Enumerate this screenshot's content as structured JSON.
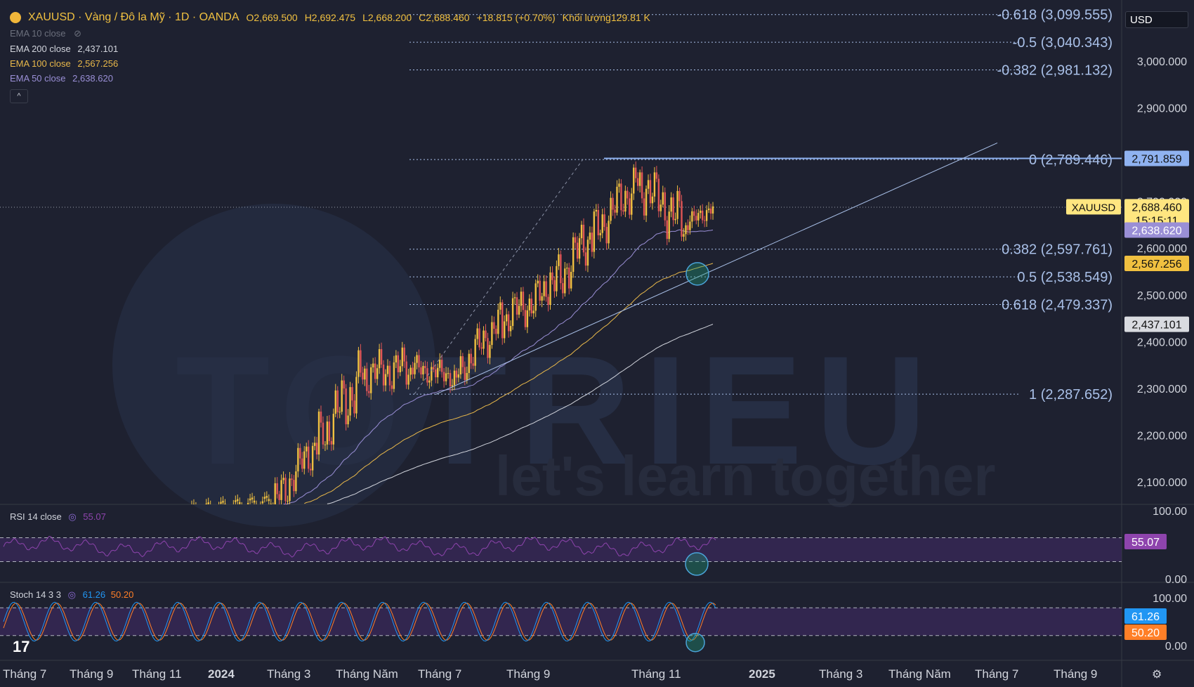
{
  "header": {
    "symbol": "XAUUSD · Vàng / Đô la Mỹ · 1D · OANDA",
    "open": "O2,669.500",
    "high": "H2,692.475",
    "low": "L2,668.200",
    "close": "C2,688.460",
    "change": "+18.815 (+0.70%)",
    "volume_label": "Khối lượng",
    "volume": "129.81 K"
  },
  "indicators": [
    {
      "label": "EMA 10 close",
      "value": "",
      "color": "#6b6f7c",
      "hidden": true
    },
    {
      "label": "EMA 200 close",
      "value": "2,437.101",
      "color": "#d1d4dc"
    },
    {
      "label": "EMA 100 close",
      "value": "2,567.256",
      "color": "#e8b84a"
    },
    {
      "label": "EMA 50 close",
      "value": "2,638.620",
      "color": "#9a8fd6"
    }
  ],
  "currency": "USD",
  "rsi": {
    "label": "RSI 14 close",
    "value": "55.07",
    "levels": [
      "100.00",
      "0.00"
    ],
    "color": "#8e44ad"
  },
  "stoch": {
    "label": "Stoch 14 3 3",
    "k": "61.26",
    "d": "50.20",
    "levels": [
      "100.00",
      "0.00"
    ],
    "k_color": "#2196f3",
    "d_color": "#ff7f27"
  },
  "price_axis": [
    "3,000.000",
    "2,900.000",
    "2,800.000",
    "2,700.000",
    "2,600.000",
    "2,500.000",
    "2,400.000",
    "2,300.000",
    "2,200.000",
    "2,100.000"
  ],
  "time_axis": [
    "Tháng 7",
    "Tháng 9",
    "Tháng 11",
    "2024",
    "Tháng 3",
    "Tháng Năm",
    "Tháng 7",
    "Tháng 9",
    "Tháng 11",
    "2025",
    "Tháng 3",
    "Tháng Năm",
    "Tháng 7",
    "Tháng 9"
  ],
  "fib_levels": [
    {
      "ratio": "-0.618",
      "price": 3099.555,
      "label": "-0.618 (3,099.555)"
    },
    {
      "ratio": "-0.5",
      "price": 3040.343,
      "label": "-0.5 (3,040.343)"
    },
    {
      "ratio": "-0.382",
      "price": 2981.132,
      "label": "-0.382 (2,981.132)"
    },
    {
      "ratio": "0",
      "price": 2789.446,
      "label": "0 (2,789.446)"
    },
    {
      "ratio": "0.382",
      "price": 2597.761,
      "label": "0.382 (2,597.761)"
    },
    {
      "ratio": "0.5",
      "price": 2538.549,
      "label": "0.5 (2,538.549)"
    },
    {
      "ratio": "0.618",
      "price": 2479.337,
      "label": "0.618 (2,479.337)"
    },
    {
      "ratio": "1",
      "price": 2287.652,
      "label": "1 (2,287.652)"
    }
  ],
  "price_tags": [
    {
      "value": 2791.859,
      "text": "2,791.859",
      "bg": "#8fb2f0",
      "fg": "#111"
    },
    {
      "value": 2688.46,
      "text": "2,688.460",
      "bg": "#ffe680",
      "fg": "#111",
      "sub": "15:15:11",
      "symbol": "XAUUSD"
    },
    {
      "value": 2638.62,
      "text": "2,638.620",
      "bg": "#9a8fd6",
      "fg": "#fff"
    },
    {
      "value": 2567.256,
      "text": "2,567.256",
      "bg": "#f0c040",
      "fg": "#111"
    },
    {
      "value": 2437.101,
      "text": "2,437.101",
      "bg": "#d9dbe0",
      "fg": "#111"
    }
  ],
  "watermark": {
    "brand": "TOTRIEU",
    "slogan": "let's learn together"
  },
  "colors": {
    "background": "#1e2130",
    "up": "#f0c040",
    "down": "#e05555",
    "fib": "#a9c0e8",
    "trend": "#a9c0e8",
    "circle": "#1fa37a"
  },
  "chart_data": {
    "type": "candlestick",
    "title": "XAUUSD · Vàng / Đô la Mỹ · 1D · OANDA",
    "ylim": [
      2050,
      3130
    ],
    "x_range_days": [
      0,
      640
    ],
    "candles_monthly_ohlc_approx": [
      {
        "month": "2024-03",
        "open": 2050,
        "high": 2195,
        "low": 2030,
        "close": 2185
      },
      {
        "month": "2024-04",
        "open": 2185,
        "high": 2431,
        "low": 2180,
        "close": 2330
      },
      {
        "month": "2024-05",
        "open": 2330,
        "high": 2450,
        "low": 2280,
        "close": 2345
      },
      {
        "month": "2024-06",
        "open": 2345,
        "high": 2388,
        "low": 2290,
        "close": 2326
      },
      {
        "month": "2024-07",
        "open": 2326,
        "high": 2484,
        "low": 2318,
        "close": 2447
      },
      {
        "month": "2024-08",
        "open": 2447,
        "high": 2531,
        "low": 2364,
        "close": 2503
      },
      {
        "month": "2024-09",
        "open": 2503,
        "high": 2685,
        "low": 2472,
        "close": 2634
      },
      {
        "month": "2024-10",
        "open": 2634,
        "high": 2790,
        "low": 2603,
        "close": 2743
      },
      {
        "month": "2024-11",
        "open": 2743,
        "high": 2762,
        "low": 2536,
        "close": 2650
      },
      {
        "month": "2024-12",
        "open": 2650,
        "high": 2692,
        "low": 2620,
        "close": 2688
      }
    ],
    "ema": [
      {
        "name": "EMA 200 close",
        "last": 2437.101
      },
      {
        "name": "EMA 100 close",
        "last": 2567.256
      },
      {
        "name": "EMA 50 close",
        "last": 2638.62
      }
    ],
    "rsi": {
      "name": "RSI 14 close",
      "last": 55.07,
      "bands": [
        70,
        30
      ]
    },
    "stoch": {
      "name": "Stoch 14 3 3",
      "k": 61.26,
      "d": 50.2,
      "bands": [
        80,
        20
      ]
    }
  }
}
